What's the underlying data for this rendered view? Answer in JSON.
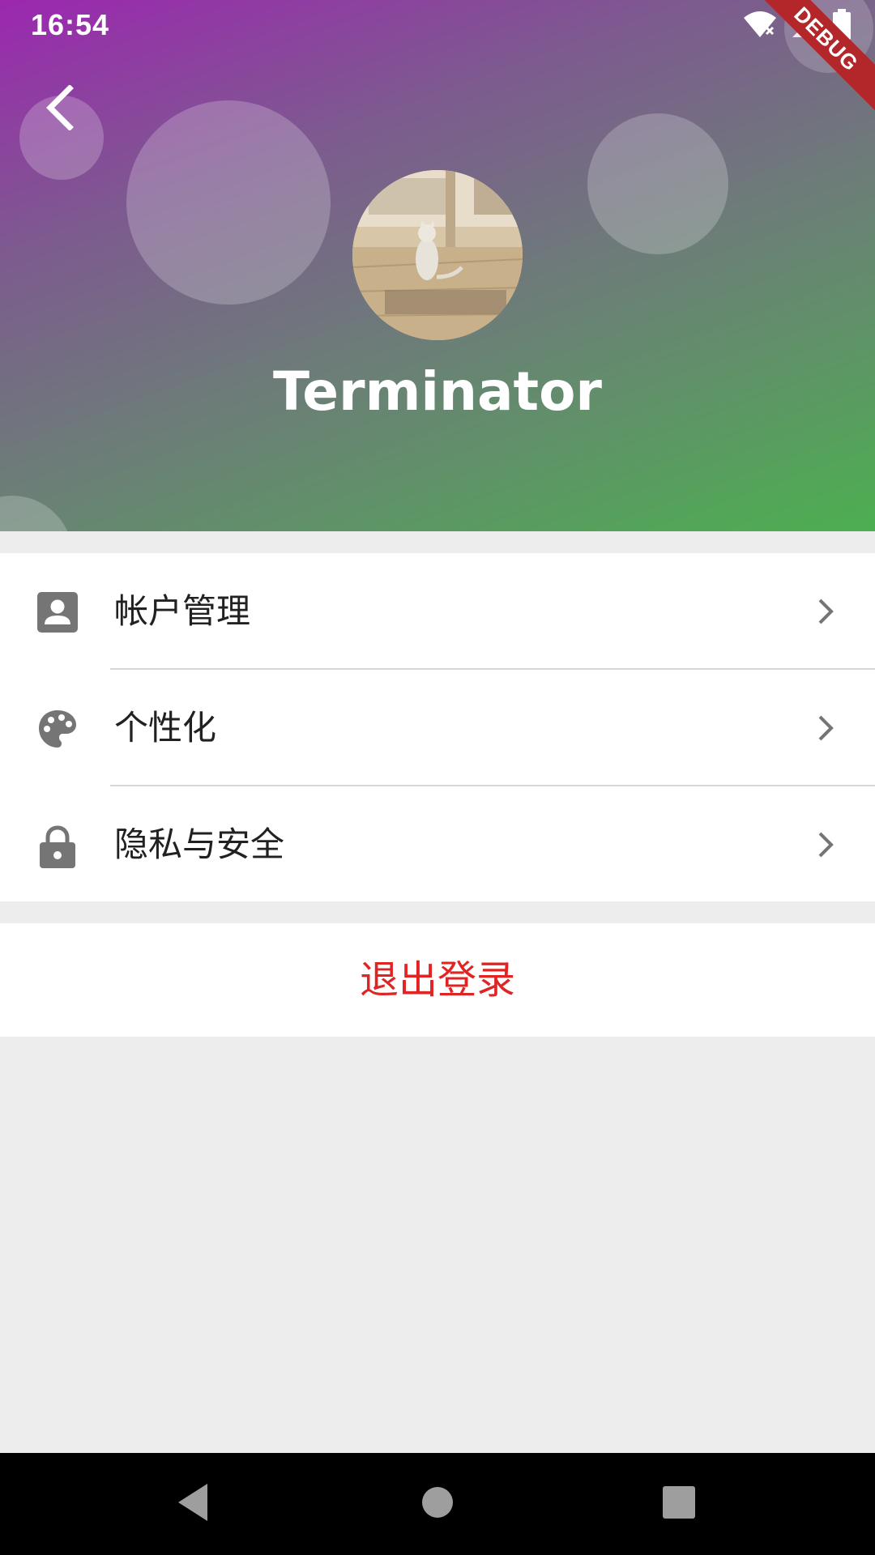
{
  "status_bar": {
    "time": "16:54",
    "icons": [
      "wifi-icon",
      "signal-icon",
      "battery-icon"
    ]
  },
  "debug_banner": "DEBUG",
  "profile": {
    "username": "Terminator",
    "avatar": "cat-avatar"
  },
  "settings": {
    "items": [
      {
        "label": "帐户管理",
        "icon": "account-box-icon"
      },
      {
        "label": "个性化",
        "icon": "palette-icon"
      },
      {
        "label": "隐私与安全",
        "icon": "lock-icon"
      }
    ]
  },
  "logout": {
    "label": "退出登录"
  },
  "nav_bar": {
    "buttons": [
      "back-triangle-icon",
      "home-circle-icon",
      "recents-square-icon"
    ]
  },
  "colors": {
    "gradient_start": "#9c27b0",
    "gradient_end": "#4caf50",
    "logout_text": "#e02424",
    "icon_grey": "#757575",
    "background": "#ededed"
  }
}
